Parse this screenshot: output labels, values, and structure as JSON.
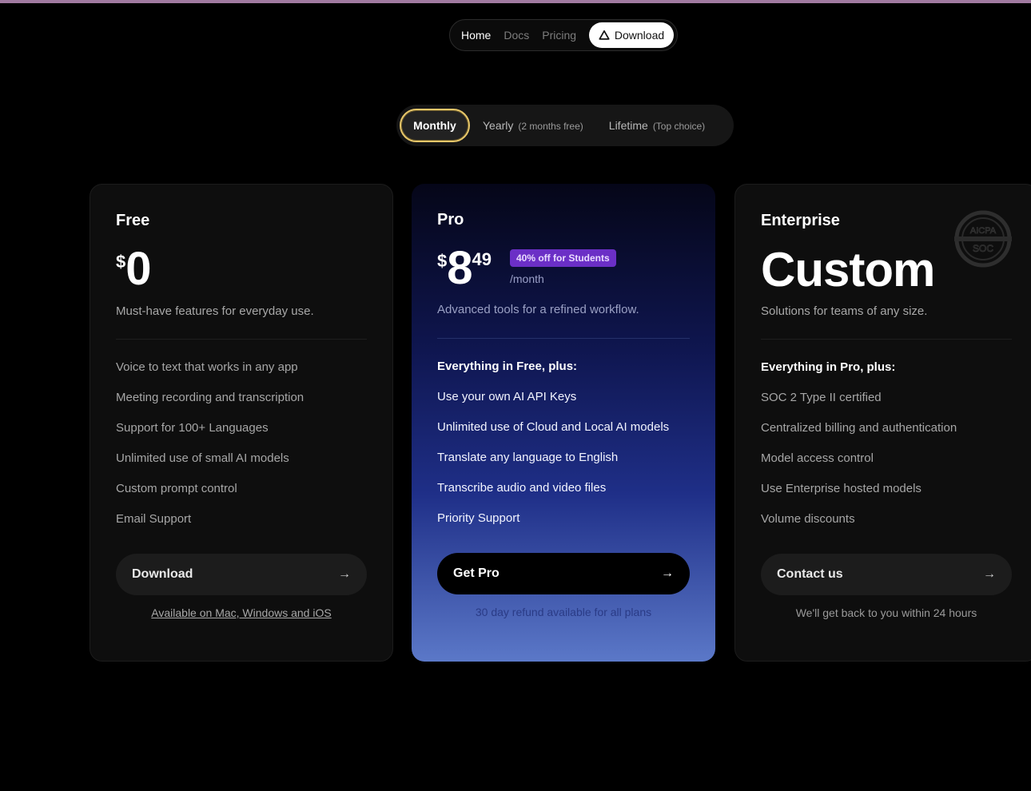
{
  "nav": {
    "items": [
      {
        "label": "Home"
      },
      {
        "label": "Docs"
      },
      {
        "label": "Pricing"
      }
    ],
    "download_label": "Download"
  },
  "billing": {
    "monthly": "Monthly",
    "yearly": "Yearly",
    "yearly_note": "(2 months free)",
    "lifetime": "Lifetime",
    "lifetime_note": "(Top choice)"
  },
  "plans": {
    "free": {
      "name": "Free",
      "currency": "$",
      "price": "0",
      "description": "Must-have features for everyday use.",
      "features": [
        "Voice to text that works in any app",
        "Meeting recording and transcription",
        "Support for 100+ Languages",
        "Unlimited use of small AI models",
        "Custom prompt control",
        "Email Support"
      ],
      "cta": "Download",
      "note": "Available on Mac, Windows and iOS"
    },
    "pro": {
      "name": "Pro",
      "currency": "$",
      "price": "8",
      "cents": "49",
      "badge": "40% off for Students",
      "period": "/month",
      "description": "Advanced tools for a refined workflow.",
      "features_heading": "Everything in Free, plus:",
      "features": [
        "Use your own AI API Keys",
        "Unlimited use of Cloud and Local AI models",
        "Translate any language to English",
        "Transcribe audio and video files",
        "Priority Support"
      ],
      "cta": "Get Pro",
      "note": "30 day refund available for all plans"
    },
    "enterprise": {
      "name": "Enterprise",
      "price": "Custom",
      "description": "Solutions for teams of any size.",
      "features_heading": "Everything in Pro, plus:",
      "features": [
        "SOC 2 Type II certified",
        "Centralized billing and authentication",
        "Model access control",
        "Use Enterprise hosted models",
        "Volume discounts"
      ],
      "cta": "Contact us",
      "note": "We'll get back to you within 24 hours",
      "seal_text_top": "AICPA",
      "seal_text_bottom": "SOC"
    }
  },
  "colors": {
    "accent_ring": "#e7c76a",
    "badge": "#6b2fc6"
  }
}
